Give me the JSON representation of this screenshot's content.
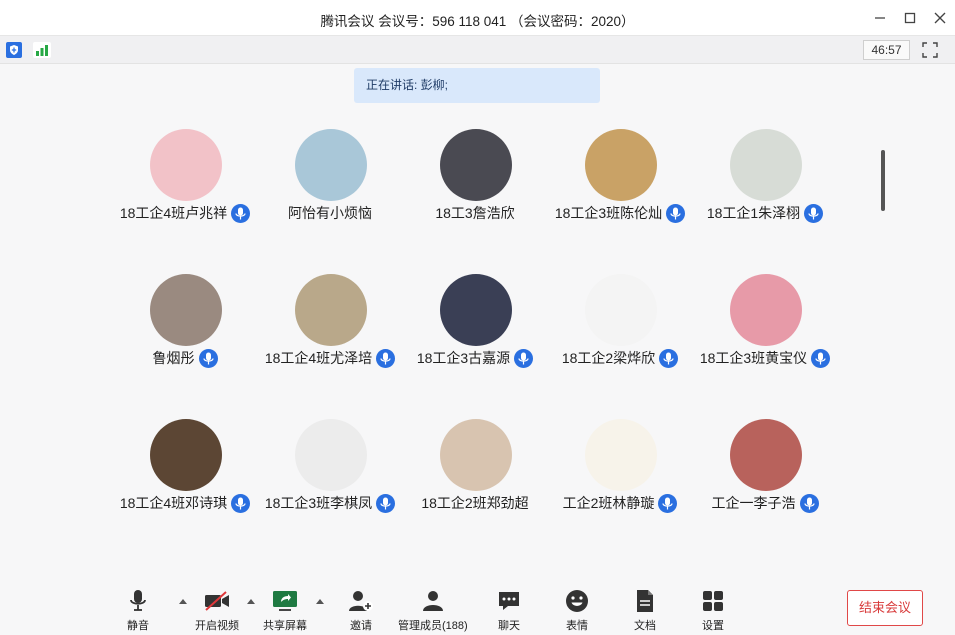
{
  "window": {
    "title": "腾讯会议 会议号：596 118 041 （会议密码：2020）"
  },
  "status": {
    "timer": "46:57"
  },
  "speaking": {
    "text": "正在讲话: 彭柳;"
  },
  "participants": [
    {
      "name": "18工企4班卢兆祥",
      "mic": true,
      "avatar_color": "#f2c2c8"
    },
    {
      "name": "阿怡有小烦恼",
      "mic": false,
      "avatar_color": "#a9c7d8"
    },
    {
      "name": "18工3詹浩欣",
      "mic": false,
      "avatar_color": "#4a4a52"
    },
    {
      "name": "18工企3班陈伦灿",
      "mic": true,
      "avatar_color": "#c9a266"
    },
    {
      "name": "18工企1朱泽栩",
      "mic": true,
      "avatar_color": "#d7dcd6"
    },
    {
      "name": "鲁烟彤",
      "mic": true,
      "avatar_color": "#9a8a80"
    },
    {
      "name": "18工企4班尤泽培",
      "mic": true,
      "avatar_color": "#b9a88a"
    },
    {
      "name": "18工企3古嘉源",
      "mic": true,
      "avatar_color": "#3a3f55"
    },
    {
      "name": "18工企2梁烨欣",
      "mic": true,
      "avatar_color": "#f4f4f4"
    },
    {
      "name": "18工企3班黄宝仪",
      "mic": true,
      "avatar_color": "#e79aa8"
    },
    {
      "name": "18工企4班邓诗琪",
      "mic": true,
      "avatar_color": "#5c4634"
    },
    {
      "name": "18工企3班李棋凤",
      "mic": true,
      "avatar_color": "#ececec"
    },
    {
      "name": "18工企2班郑劲超",
      "mic": false,
      "avatar_color": "#d8c4b0"
    },
    {
      "name": "工企2班林静璇",
      "mic": true,
      "avatar_color": "#f7f3ea"
    },
    {
      "name": "工企一李子浩",
      "mic": true,
      "avatar_color": "#b8625c"
    }
  ],
  "toolbar": {
    "mute": "静音",
    "video": "开启视频",
    "share": "共享屏幕",
    "invite": "邀请",
    "members": "管理成员(188)",
    "chat": "聊天",
    "emoji": "表情",
    "docs": "文档",
    "settings": "设置",
    "end": "结束会议"
  },
  "colors": {
    "accent": "#2a6fe0",
    "end_red": "#d83b3b",
    "speaking_bg": "#d9e8fb"
  }
}
